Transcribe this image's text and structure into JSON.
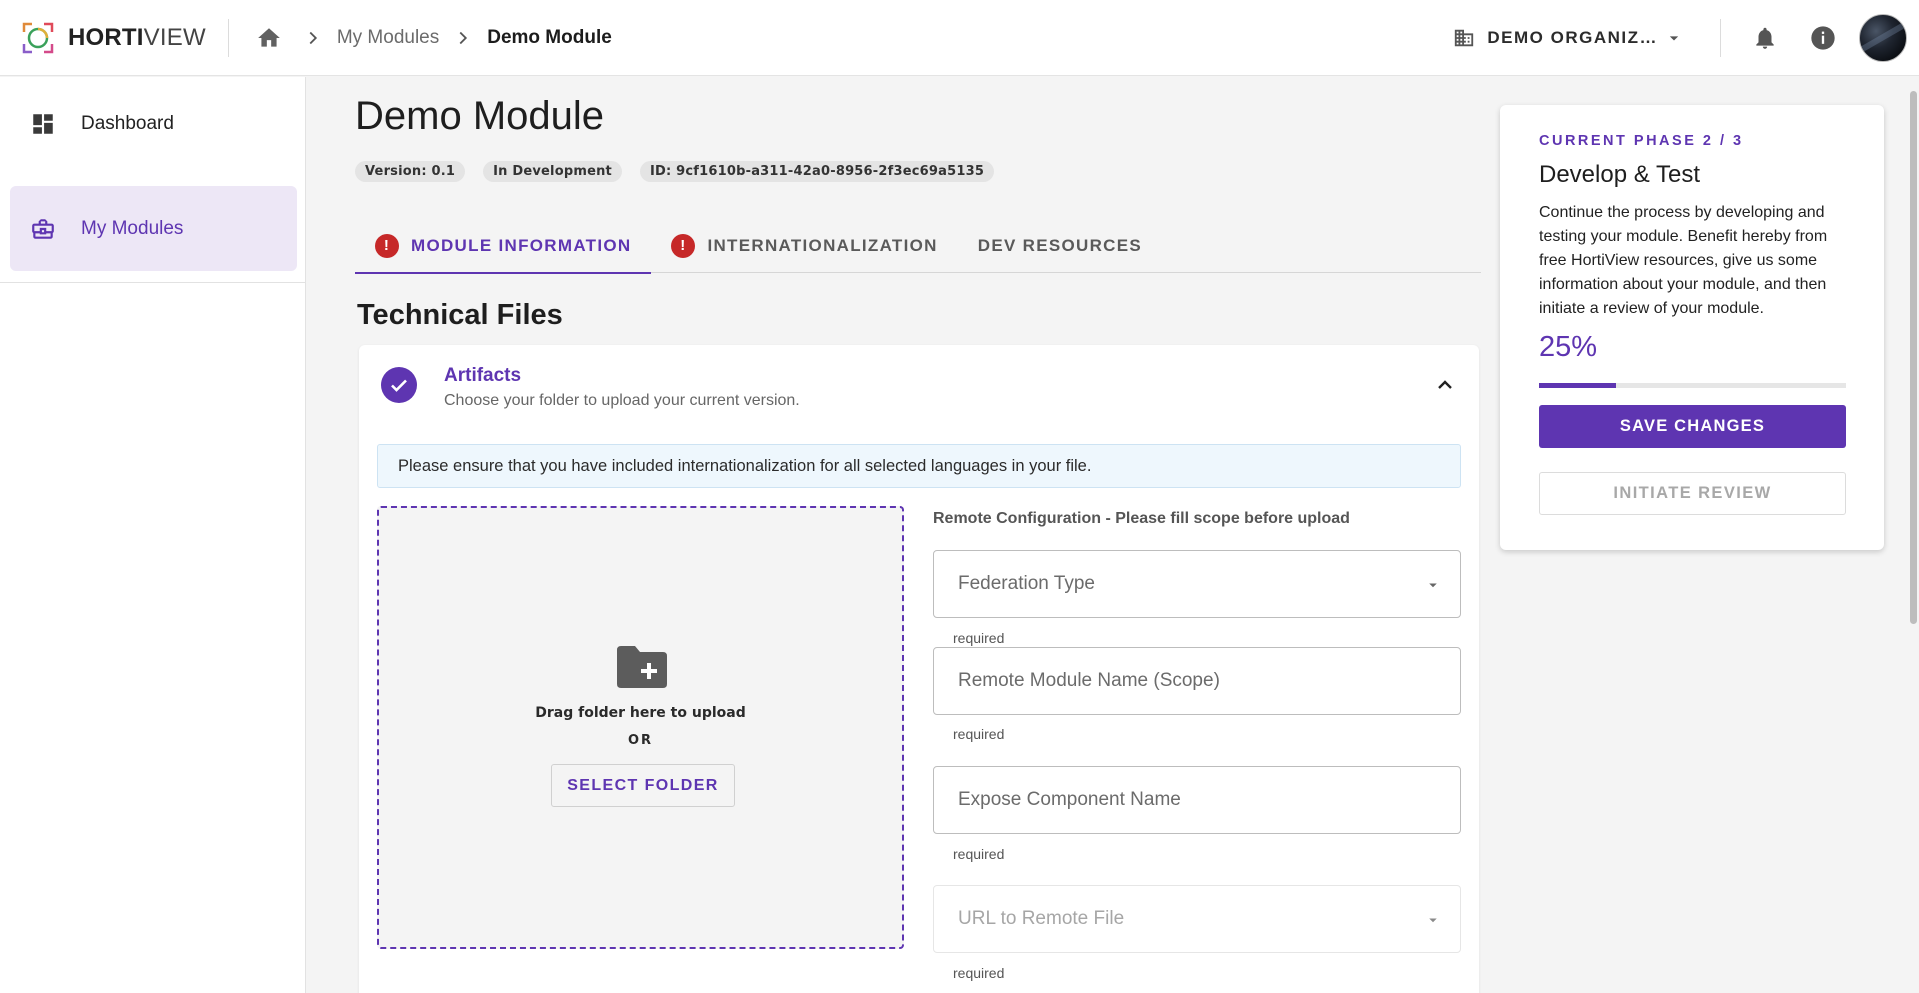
{
  "header": {
    "logo_bold": "HORTI",
    "logo_light": "VIEW",
    "breadcrumb": [
      "My Modules",
      "Demo Module"
    ],
    "organization": "DEMO ORGANIZ…",
    "icons": [
      "home-icon",
      "chevron-right-icon",
      "building-icon",
      "caret-down-icon",
      "bell-icon",
      "info-icon"
    ]
  },
  "sidebar": {
    "items": [
      {
        "label": "Dashboard",
        "icon": "dashboard-icon",
        "active": false
      },
      {
        "label": "My Modules",
        "icon": "briefcase-icon",
        "active": true
      }
    ]
  },
  "main": {
    "title": "Demo Module",
    "chips": [
      "Version: 0.1",
      "In Development",
      "ID: 9cf1610b-a311-42a0-8956-2f3ec69a5135"
    ],
    "tabs": [
      {
        "label": "MODULE INFORMATION",
        "alert": true,
        "active": true
      },
      {
        "label": "INTERNATIONALIZATION",
        "alert": true,
        "active": false
      },
      {
        "label": "DEV RESOURCES",
        "alert": false,
        "active": false
      }
    ],
    "section_title": "Technical Files",
    "artifacts": {
      "title": "Artifacts",
      "subtitle": "Choose your folder to upload your current version.",
      "info": "Please ensure that you have included internationalization for all selected languages in your file.",
      "dropzone": {
        "text": "Drag folder here to upload",
        "or": "OR",
        "button": "SELECT FOLDER"
      },
      "remote_config": {
        "title": "Remote Configuration - Please fill scope before upload",
        "fields": [
          {
            "label": "Federation Type",
            "helper": "required",
            "type": "select",
            "disabled": false
          },
          {
            "label": "Remote Module Name (Scope)",
            "helper": "required",
            "type": "text",
            "disabled": false
          },
          {
            "label": "Expose Component Name",
            "helper": "required",
            "type": "text",
            "disabled": false
          },
          {
            "label": "URL to Remote File",
            "helper": "required",
            "type": "select",
            "disabled": true
          }
        ]
      }
    }
  },
  "phase": {
    "overline": "CURRENT PHASE 2 / 3",
    "title": "Develop & Test",
    "body": "Continue the process by developing and testing your module. Benefit hereby from free HortiView resources, give us some information about your module, and then initiate a review of your module.",
    "percent_label": "25%",
    "progress": 0.25,
    "save_button": "SAVE CHANGES",
    "review_button": "INITIATE REVIEW"
  },
  "colors": {
    "accent": "#5e35b1",
    "accent_light": "#ede7f6",
    "alert": "#c62828",
    "info_bg": "#eef7fd"
  }
}
